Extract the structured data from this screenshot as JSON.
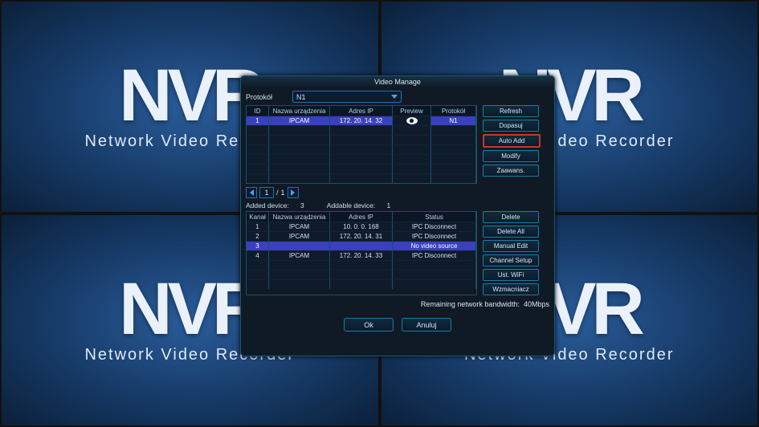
{
  "bg": {
    "logo": "NVR",
    "sub": "Network Video Recorder"
  },
  "dialog": {
    "title": "Video Manage",
    "protocol_label": "Protokół",
    "protocol_value": "N1",
    "upper_headers": [
      "ID",
      "Nazwa urządzenia",
      "Adres IP",
      "Preview",
      "Protokół"
    ],
    "upper_rows": [
      {
        "id": "1",
        "name": "IPCAM",
        "ip": "172. 20. 14. 32",
        "proto": "N1",
        "selected": true
      }
    ],
    "upper_empty_rows": 6,
    "pager": {
      "current": "1",
      "total": "1"
    },
    "counts": {
      "added_label": "Added device:",
      "added_value": "3",
      "addable_label": "Addable device:",
      "addable_value": "1"
    },
    "lower_headers": [
      "Kanał",
      "Nazwa urządzenia",
      "Adres IP",
      "Status"
    ],
    "lower_rows": [
      {
        "ch": "1",
        "name": "IPCAM",
        "ip": "10. 0. 0. 168",
        "status": "IPC Disconnect",
        "selected": false
      },
      {
        "ch": "2",
        "name": "IPCAM",
        "ip": "172. 20. 14. 31",
        "status": "IPC Disconnect",
        "selected": false
      },
      {
        "ch": "3",
        "name": "",
        "ip": "",
        "status": "No video source",
        "selected": true
      },
      {
        "ch": "4",
        "name": "IPCAM",
        "ip": "172. 20. 14. 33",
        "status": "IPC Disconnect",
        "selected": false
      }
    ],
    "lower_empty_rows": 3,
    "btns_upper": [
      "Refresh",
      "Dopasuj",
      "Auto Add",
      "Modify",
      "Zaawans."
    ],
    "btns_upper_highlight": 2,
    "btns_lower": [
      "Delete",
      "Delete All",
      "Manual Edit",
      "Channel Setup",
      "Ust. WiFi",
      "Wzmacniacz"
    ],
    "bw_label": "Remaining network bandwidth:",
    "bw_value": "40Mbps",
    "ok": "Ok",
    "cancel": "Anuluj"
  }
}
